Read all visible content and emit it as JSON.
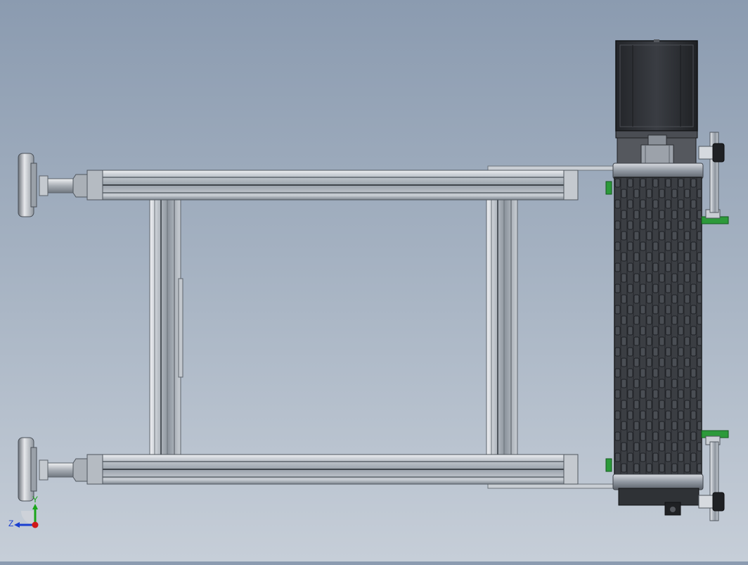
{
  "viewport": {
    "background_top": "#8b9bb0",
    "background_bottom": "#c6ced8"
  },
  "triad": {
    "y_label": "Y",
    "z_label": "Z",
    "x_color": "#d01818",
    "y_color": "#1aa51a",
    "z_color": "#1a3fd0"
  },
  "colors": {
    "aluminum_light": "#d9dde2",
    "aluminum_mid": "#aab1b9",
    "aluminum_dark": "#6f7780",
    "belt_dark": "#3a3d42",
    "motor_dark": "#2c2e32",
    "guide_green": "#2c9a3a"
  },
  "components": [
    "leveling-foot-top",
    "leveling-foot-bottom",
    "top-rail",
    "bottom-rail",
    "left-crossbar",
    "right-crossbar",
    "conveyor-belt-roller",
    "drive-motor",
    "side-guide-bracket-top",
    "side-guide-bracket-bottom"
  ]
}
